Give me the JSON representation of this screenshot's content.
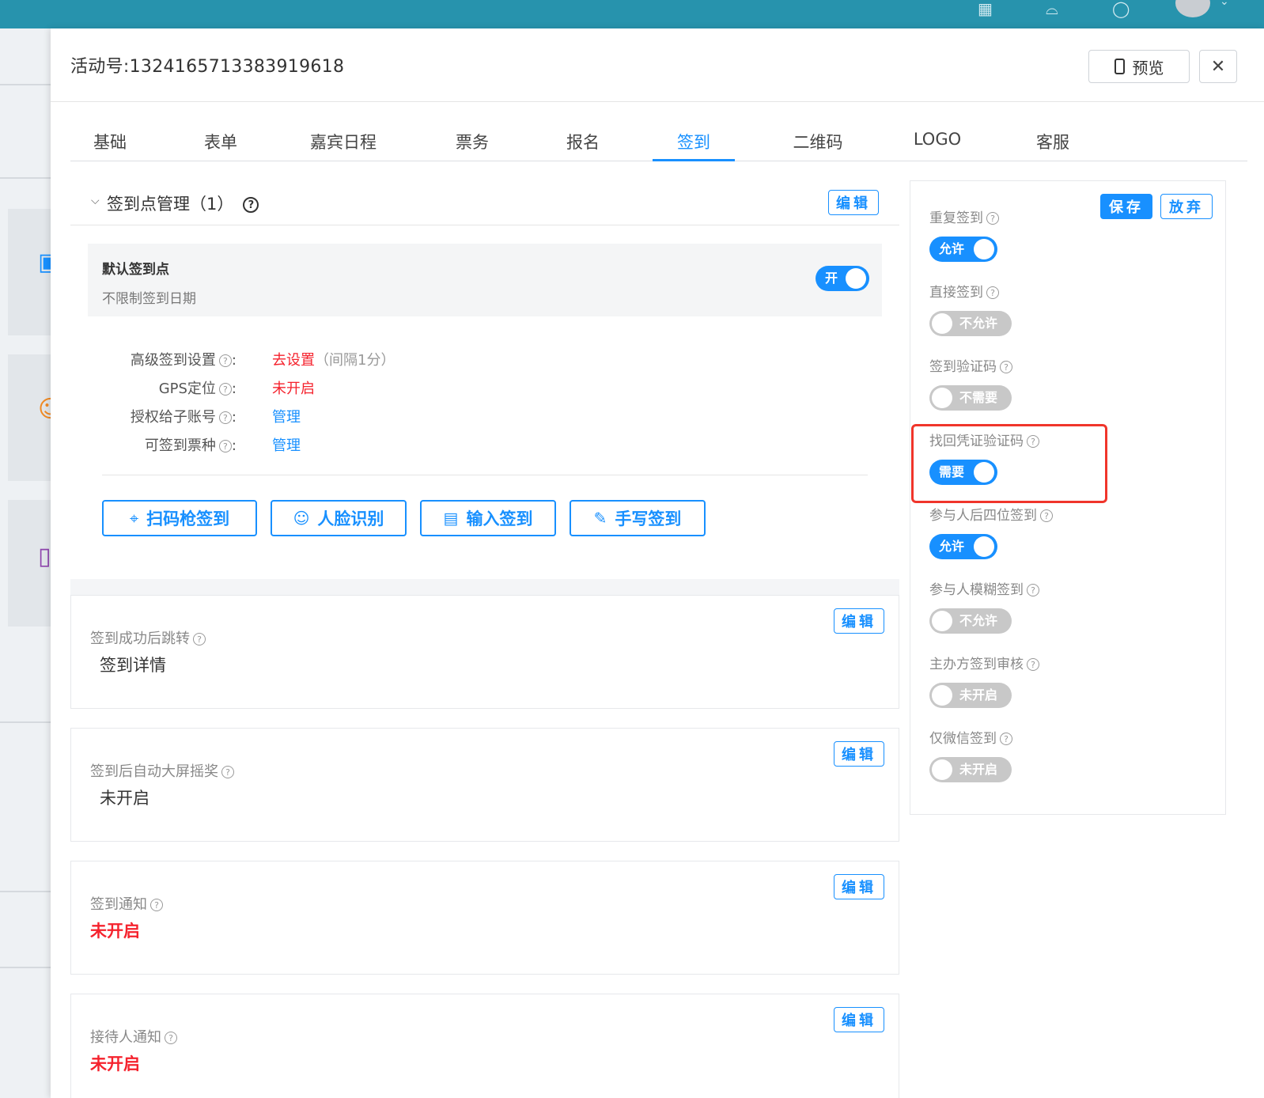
{
  "topbar": {
    "icons": [
      "qr-code-icon",
      "bell-icon",
      "help-icon",
      "user-avatar"
    ]
  },
  "header": {
    "title": "活动号:1324165713383919618",
    "preview_label": "预览",
    "close_glyph": "✕"
  },
  "tabs": [
    {
      "label": "基础"
    },
    {
      "label": "表单"
    },
    {
      "label": "嘉宾日程"
    },
    {
      "label": "票务"
    },
    {
      "label": "报名"
    },
    {
      "label": "签到",
      "active": true
    },
    {
      "label": "二维码"
    },
    {
      "label": "LOGO"
    },
    {
      "label": "客服"
    }
  ],
  "checkin_points": {
    "title": "签到点管理（1）",
    "edit_label": "编辑",
    "default_point": {
      "name": "默认签到点",
      "subtitle": "不限制签到日期",
      "toggle_label": "开"
    },
    "advanced": [
      {
        "label": "高级签到设置",
        "value": "去设置",
        "extra": "（间隔1分）",
        "color": "red"
      },
      {
        "label": "GPS定位",
        "value": "未开启",
        "color": "red"
      },
      {
        "label": "授权给子账号",
        "value": "管理",
        "color": "blue"
      },
      {
        "label": "可签到票种",
        "value": "管理",
        "color": "blue"
      }
    ],
    "actions": [
      {
        "label": "扫码枪签到",
        "icon": "scanner-icon"
      },
      {
        "label": "人脸识别",
        "icon": "face-icon"
      },
      {
        "label": "输入签到",
        "icon": "calendar-icon"
      },
      {
        "label": "手写签到",
        "icon": "pencil-icon"
      }
    ]
  },
  "config_panels": [
    {
      "label": "签到成功后跳转",
      "value": "签到详情",
      "edit_label": "编辑"
    },
    {
      "label": "签到后自动大屏摇奖",
      "value": "未开启",
      "edit_label": "编辑"
    },
    {
      "label": "签到通知",
      "value": "未开启",
      "edit_label": "编辑",
      "value_color": "red"
    },
    {
      "label": "接待人通知",
      "value": "未开启",
      "edit_label": "编辑",
      "value_color": "red"
    }
  ],
  "side_settings": {
    "save_label": "保存",
    "discard_label": "放弃",
    "items": [
      {
        "label": "重复签到",
        "state": "允许",
        "on": true
      },
      {
        "label": "直接签到",
        "state": "不允许",
        "on": false
      },
      {
        "label": "签到验证码",
        "state": "不需要",
        "on": false
      },
      {
        "label": "找回凭证验证码",
        "state": "需要",
        "on": true
      },
      {
        "label": "参与人后四位签到",
        "state": "允许",
        "on": true
      },
      {
        "label": "参与人模糊签到",
        "state": "不允许",
        "on": false
      },
      {
        "label": "主办方签到审核",
        "state": "未开启",
        "on": false
      },
      {
        "label": "仅微信签到",
        "state": "未开启",
        "on": false
      }
    ]
  },
  "colors": {
    "topbar": "#2793ad",
    "primary": "#1890ff",
    "danger": "#f5222d",
    "highlight": "#f0352b"
  }
}
